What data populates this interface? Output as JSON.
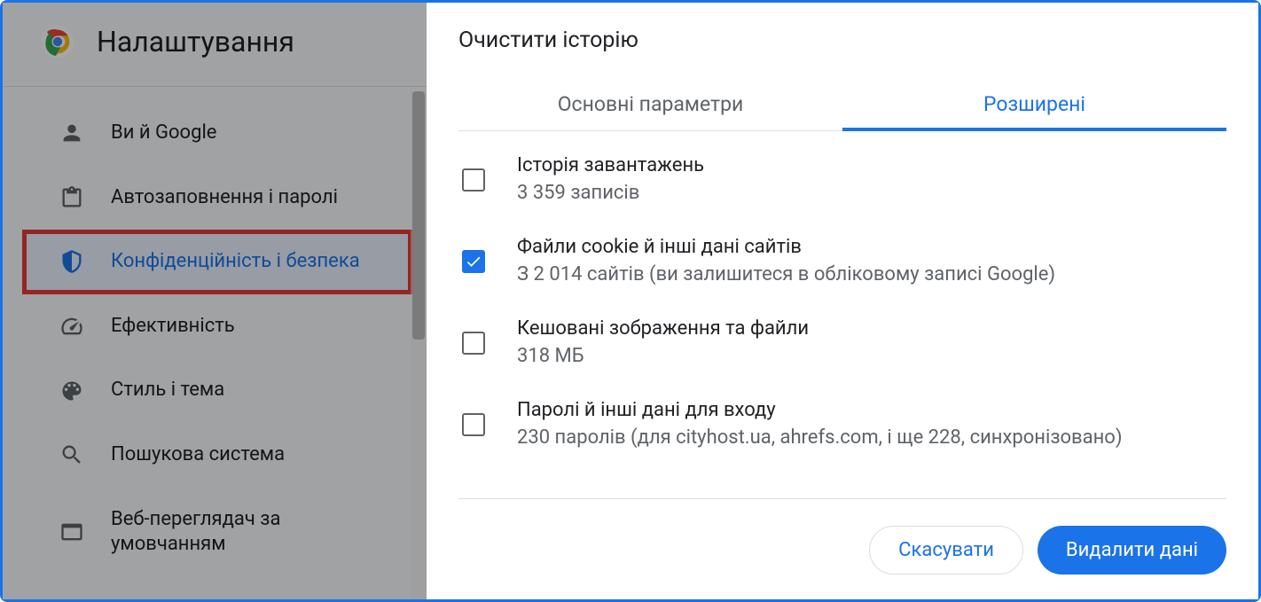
{
  "sidebar": {
    "title": "Налаштування",
    "items": [
      {
        "label": "Ви й Google"
      },
      {
        "label": "Автозаповнення і паролі"
      },
      {
        "label": "Конфіденційність і безпека"
      },
      {
        "label": "Ефективність"
      },
      {
        "label": "Стиль і тема"
      },
      {
        "label": "Пошукова система"
      },
      {
        "label": "Веб-переглядач за умовчанням"
      }
    ]
  },
  "dialog": {
    "title": "Очистити історію",
    "tabs": {
      "basic": "Основні параметри",
      "advanced": "Розширені"
    },
    "options": [
      {
        "title": "Історія завантажень",
        "desc": "3 359 записів",
        "checked": false
      },
      {
        "title": "Файли cookie й інші дані сайтів",
        "desc": "З 2 014 сайтів (ви залишитеся в обліковому записі Google)",
        "checked": true
      },
      {
        "title": "Кешовані зображення та файли",
        "desc": "318 МБ",
        "checked": false
      },
      {
        "title": "Паролі й інші дані для входу",
        "desc": "230 паролів (для cityhost.ua, ahrefs.com, і ще 228, синхронізовано)",
        "checked": false
      }
    ],
    "buttons": {
      "cancel": "Скасувати",
      "confirm": "Видалити дані"
    }
  }
}
